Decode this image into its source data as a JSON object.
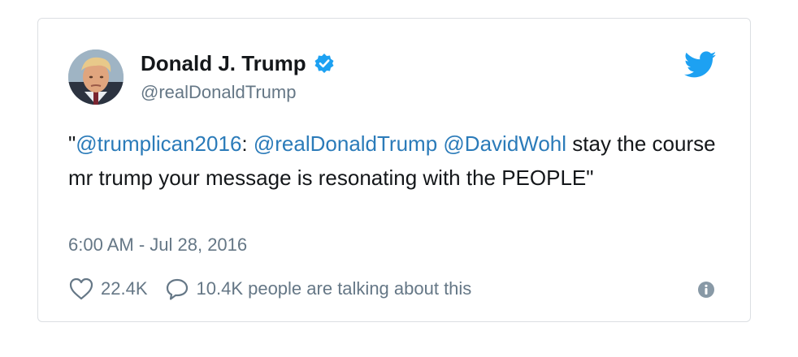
{
  "tweet": {
    "display_name": "Donald J. Trump",
    "handle": "@realDonaldTrump",
    "verified": true,
    "text_parts": {
      "quote_open": "\"",
      "mention_1": "@trumplican2016",
      "colon": ":",
      "mention_2": "@realDonaldTrump",
      "mention_3": "@DavidWohl",
      "body": "stay the course mr trump your message is resonating with the PEOPLE\""
    },
    "timestamp": "6:00 AM - Jul 28, 2016",
    "likes": "22.4K",
    "replies_text": "10.4K people are talking about this"
  },
  "icons": {
    "avatar": "profile-photo",
    "verified": "verified-badge-icon",
    "logo": "twitter-bird-icon",
    "like": "heart-icon",
    "reply": "speech-bubble-icon",
    "info": "info-icon"
  },
  "colors": {
    "link": "#2b7bb9",
    "verified": "#1da1f2",
    "bird": "#1da1f2",
    "meta_text": "#657786",
    "main_text": "#14171a",
    "border": "#dcdfe3"
  }
}
